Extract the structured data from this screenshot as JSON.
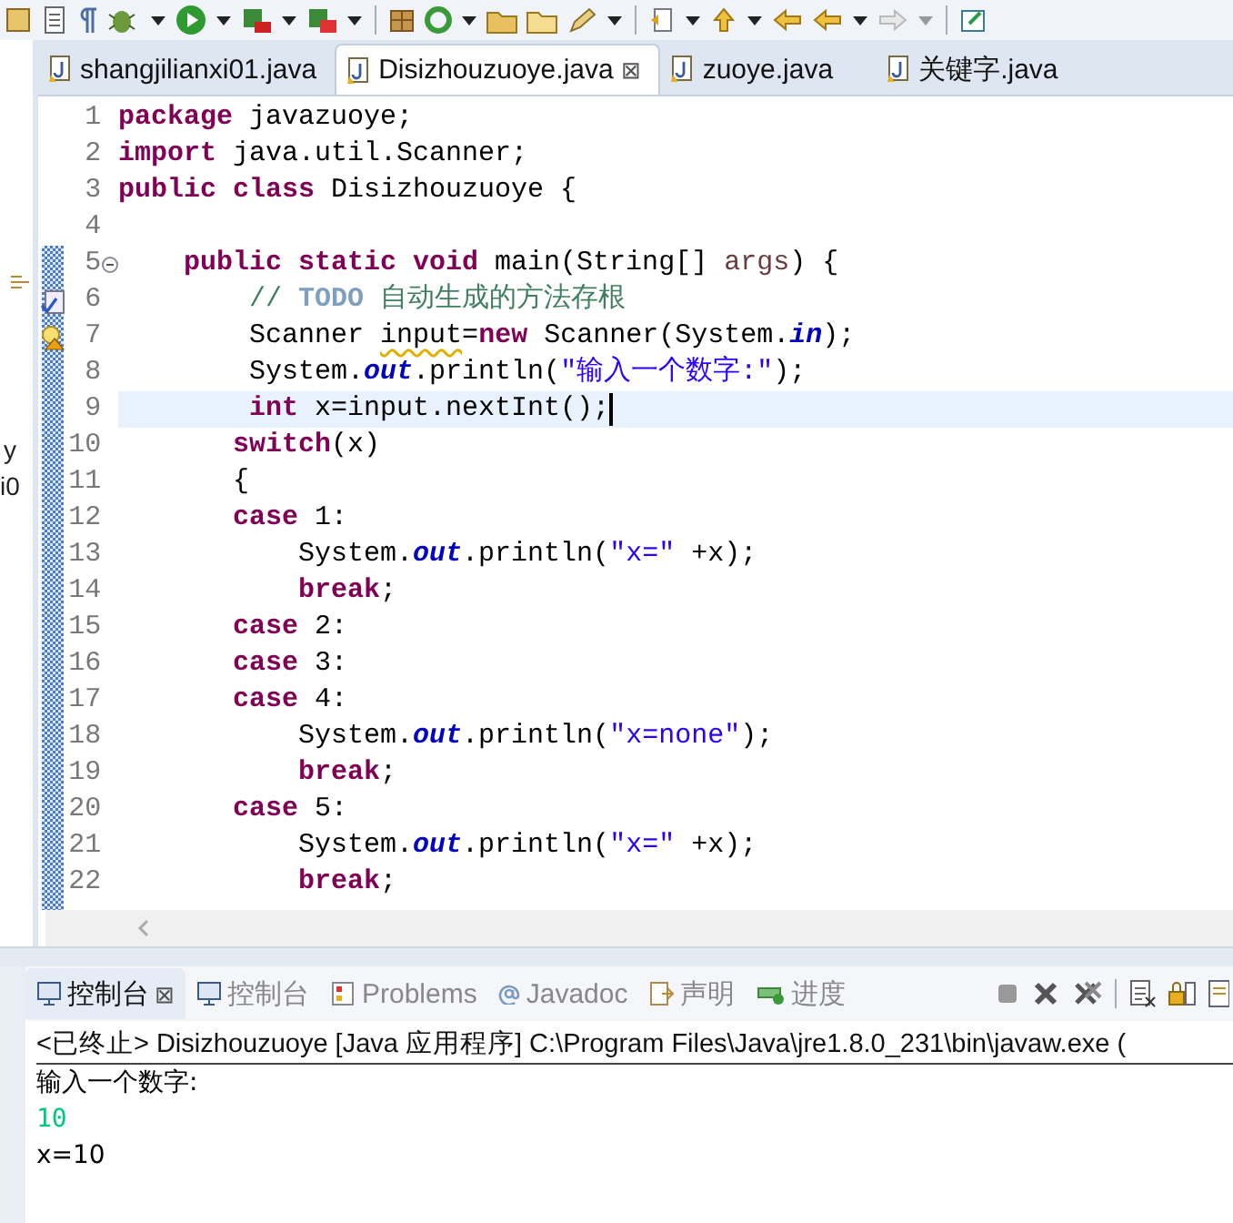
{
  "side_fragments": [
    "y",
    "i0"
  ],
  "editor_tabs": [
    {
      "label": "shangjilianxi01.java",
      "selected": false
    },
    {
      "label": "Disizhouzuoye.java",
      "selected": true,
      "close": "⊠"
    },
    {
      "label": "zuoye.java",
      "selected": false
    },
    {
      "label": "关键字.java",
      "selected": false
    }
  ],
  "code_lines": [
    {
      "number": "1",
      "tokens": [
        {
          "kind": "keyword",
          "text": "package"
        },
        {
          "kind": "plain",
          "text": " javazuoye;"
        }
      ]
    },
    {
      "number": "2",
      "tokens": [
        {
          "kind": "keyword",
          "text": "import"
        },
        {
          "kind": "plain",
          "text": " java.util.Scanner;"
        }
      ]
    },
    {
      "number": "3",
      "tokens": [
        {
          "kind": "keyword",
          "text": "public"
        },
        {
          "kind": "keyword",
          "text": " class"
        },
        {
          "kind": "plain",
          "text": " Disizhouzuoye {"
        }
      ]
    },
    {
      "number": "4"
    },
    {
      "number": "5",
      "kind": "fold",
      "tokens": [
        {
          "kind": "keyword",
          "text": "    public"
        },
        {
          "kind": "keyword",
          "text": " static"
        },
        {
          "kind": "keyword",
          "text": " void"
        },
        {
          "kind": "plain",
          "text": " main(String[] "
        },
        {
          "kind": "param",
          "text": "args"
        },
        {
          "kind": "plain",
          "text": ") {"
        }
      ]
    },
    {
      "number": "6",
      "kind": "task",
      "tokens": [
        {
          "kind": "comment",
          "text": "        // "
        },
        {
          "kind": "todo",
          "text": "TODO"
        },
        {
          "kind": "comment",
          "text": " 自动生成的方法存根"
        }
      ]
    },
    {
      "number": "7",
      "kind": "warning",
      "tokens": [
        {
          "kind": "plain",
          "text": "        Scanner "
        },
        {
          "kind": "warn",
          "text": "input"
        },
        {
          "kind": "plain",
          "text": "="
        },
        {
          "kind": "keyword",
          "text": "new"
        },
        {
          "kind": "plain",
          "text": " Scanner(System."
        },
        {
          "kind": "field",
          "text": "in"
        },
        {
          "kind": "plain",
          "text": ");"
        }
      ]
    },
    {
      "number": "8",
      "tokens": [
        {
          "kind": "plain",
          "text": "        System."
        },
        {
          "kind": "field",
          "text": "out"
        },
        {
          "kind": "plain",
          "text": ".println("
        },
        {
          "kind": "string",
          "text": "\"输入一个数字:\""
        },
        {
          "kind": "plain",
          "text": ");"
        }
      ]
    },
    {
      "number": "9",
      "current": true,
      "tokens": [
        {
          "kind": "keyword",
          "text": "        int"
        },
        {
          "kind": "plain",
          "text": " x=input.nextInt();"
        }
      ]
    },
    {
      "number": "10",
      "tokens": [
        {
          "kind": "keyword",
          "text": "       switch"
        },
        {
          "kind": "plain",
          "text": "(x)"
        }
      ]
    },
    {
      "number": "11",
      "tokens": [
        {
          "kind": "plain",
          "text": "       {"
        }
      ]
    },
    {
      "number": "12",
      "tokens": [
        {
          "kind": "keyword",
          "text": "       case"
        },
        {
          "kind": "plain",
          "text": " 1:"
        }
      ]
    },
    {
      "number": "13",
      "tokens": [
        {
          "kind": "plain",
          "text": "           System."
        },
        {
          "kind": "field",
          "text": "out"
        },
        {
          "kind": "plain",
          "text": ".println("
        },
        {
          "kind": "string",
          "text": "\"x=\""
        },
        {
          "kind": "plain",
          "text": " +x);"
        }
      ]
    },
    {
      "number": "14",
      "tokens": [
        {
          "kind": "keyword",
          "text": "           break"
        },
        {
          "kind": "plain",
          "text": ";"
        }
      ]
    },
    {
      "number": "15",
      "tokens": [
        {
          "kind": "keyword",
          "text": "       case"
        },
        {
          "kind": "plain",
          "text": " 2:"
        }
      ]
    },
    {
      "number": "16",
      "tokens": [
        {
          "kind": "keyword",
          "text": "       case"
        },
        {
          "kind": "plain",
          "text": " 3:"
        }
      ]
    },
    {
      "number": "17",
      "tokens": [
        {
          "kind": "keyword",
          "text": "       case"
        },
        {
          "kind": "plain",
          "text": " 4:"
        }
      ]
    },
    {
      "number": "18",
      "tokens": [
        {
          "kind": "plain",
          "text": "           System."
        },
        {
          "kind": "field",
          "text": "out"
        },
        {
          "kind": "plain",
          "text": ".println("
        },
        {
          "kind": "string",
          "text": "\"x=none\""
        },
        {
          "kind": "plain",
          "text": ");"
        }
      ]
    },
    {
      "number": "19",
      "tokens": [
        {
          "kind": "keyword",
          "text": "           break"
        },
        {
          "kind": "plain",
          "text": ";"
        }
      ]
    },
    {
      "number": "20",
      "tokens": [
        {
          "kind": "keyword",
          "text": "       case"
        },
        {
          "kind": "plain",
          "text": " 5:"
        }
      ]
    },
    {
      "number": "21",
      "tokens": [
        {
          "kind": "plain",
          "text": "           System."
        },
        {
          "kind": "field",
          "text": "out"
        },
        {
          "kind": "plain",
          "text": ".println("
        },
        {
          "kind": "string",
          "text": "\"x=\""
        },
        {
          "kind": "plain",
          "text": " +x);"
        }
      ]
    },
    {
      "number": "22",
      "tokens": [
        {
          "kind": "keyword",
          "text": "           break"
        },
        {
          "kind": "plain",
          "text": ";"
        }
      ]
    }
  ],
  "console_tabs": [
    {
      "label": "控制台",
      "kind": "console",
      "selected": true,
      "close": "⊠"
    },
    {
      "label": "控制台",
      "kind": "console",
      "selected": false
    },
    {
      "label": "Problems",
      "kind": "problems",
      "selected": false
    },
    {
      "label": "Javadoc",
      "kind": "javadoc",
      "selected": false
    },
    {
      "label": "声明",
      "kind": "declaration",
      "selected": false
    },
    {
      "label": "进度",
      "kind": "progress",
      "selected": false
    }
  ],
  "console_header": "<已终止> Disizhouzuoye [Java 应用程序] C:\\Program Files\\Java\\jre1.8.0_231\\bin\\javaw.exe  (",
  "console_output": [
    {
      "kind": "output",
      "text": "输入一个数字:"
    },
    {
      "kind": "input",
      "text": "10"
    },
    {
      "kind": "output",
      "text": "x=10"
    }
  ]
}
